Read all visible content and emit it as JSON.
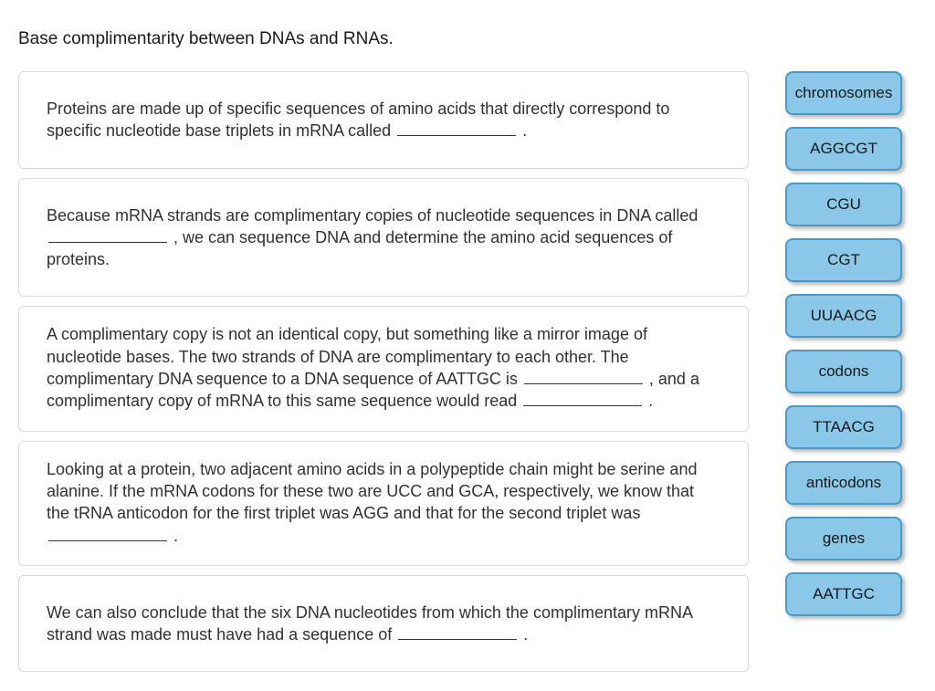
{
  "title": "Base complimentarity between DNAs and RNAs.",
  "questions": [
    {
      "segments": [
        {
          "t": "text",
          "v": "Proteins are made up of specific sequences of amino acids that directly correspond to specific nucleotide base triplets in mRNA called "
        },
        {
          "t": "blank"
        },
        {
          "t": "text",
          "v": " ."
        }
      ],
      "tight": false
    },
    {
      "segments": [
        {
          "t": "text",
          "v": "Because mRNA strands are complimentary copies of nucleotide sequences in DNA called "
        },
        {
          "t": "blank"
        },
        {
          "t": "text",
          "v": " , we can sequence DNA and determine the amino acid sequences of proteins."
        }
      ],
      "tight": false
    },
    {
      "segments": [
        {
          "t": "text",
          "v": "A complimentary copy is not an identical copy, but something like a mirror image of nucleotide bases. The two strands of DNA are complimentary to each other. The complimentary DNA sequence to a DNA sequence of AATTGC is "
        },
        {
          "t": "blank"
        },
        {
          "t": "text",
          "v": " , and a complimentary copy of mRNA to this same sequence would read "
        },
        {
          "t": "blank"
        },
        {
          "t": "text",
          "v": " ."
        }
      ],
      "tight": true
    },
    {
      "segments": [
        {
          "t": "text",
          "v": "Looking at a protein, two adjacent amino acids in a polypeptide chain might be serine and alanine. If the mRNA codons for these two are UCC and GCA, respectively, we know that the tRNA anticodon for the first triplet was AGG and that for the second triplet was "
        },
        {
          "t": "blank"
        },
        {
          "t": "text",
          "v": " ."
        }
      ],
      "tight": true
    },
    {
      "segments": [
        {
          "t": "text",
          "v": "We can also conclude that the six DNA nucleotides from which the complimentary mRNA strand was made must have had a sequence of "
        },
        {
          "t": "blank"
        },
        {
          "t": "text",
          "v": " ."
        }
      ],
      "tight": false
    }
  ],
  "answers": [
    "chromosomes",
    "AGGCGT",
    "CGU",
    "CGT",
    "UUAACG",
    "codons",
    "TTAACG",
    "anticodons",
    "genes",
    "AATTGC"
  ]
}
